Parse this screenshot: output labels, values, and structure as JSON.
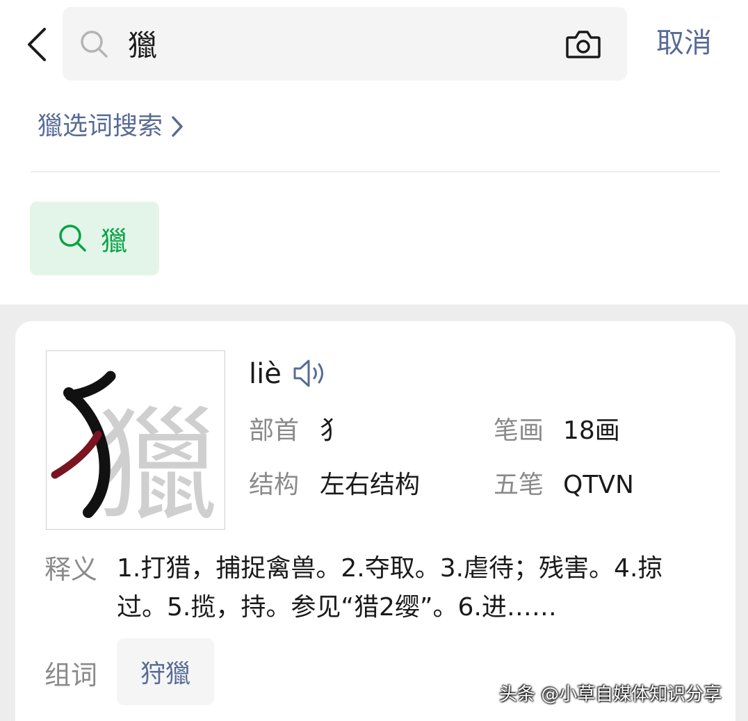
{
  "search": {
    "query": "獵",
    "cancel_label": "取消"
  },
  "select_search": {
    "label": "獵选词搜索"
  },
  "suggestion_chip": {
    "label": "獵"
  },
  "dict_card": {
    "character": "獵",
    "pinyin": "liè",
    "radical_label": "部首",
    "radical_value": "犭",
    "strokes_label": "笔画",
    "strokes_value": "18画",
    "structure_label": "结构",
    "structure_value": "左右结构",
    "wubi_label": "五笔",
    "wubi_value": "QTVN",
    "definition_label": "释义",
    "definition_text": "1.打猎，捕捉禽兽。2.夺取。3.虐待；残害。4.掠过。5.揽，持。参见“猎2缨”。6.进……",
    "words_label": "组词",
    "words": [
      "狩獵"
    ]
  },
  "watermark": "头条 @小草自媒体知识分享",
  "colors": {
    "accent_link": "#576b95",
    "accent_green": "#07a345",
    "chip_green_bg": "#e3f5e8",
    "stroke_highlight": "#7a1420"
  },
  "icons": [
    "back-icon",
    "search-icon",
    "camera-icon",
    "chevron-right-icon",
    "speaker-icon"
  ]
}
